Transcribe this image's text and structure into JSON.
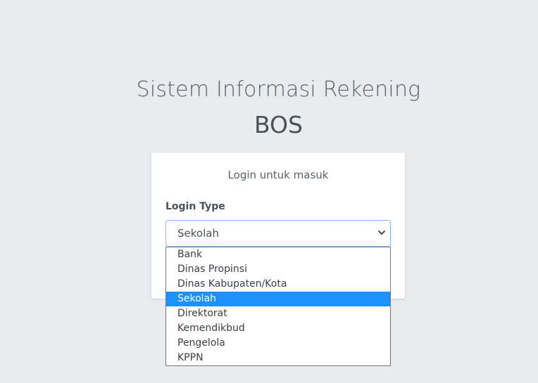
{
  "header": {
    "title": "Sistem Informasi Rekening",
    "subtitle": "BOS"
  },
  "login": {
    "message": "Login untuk masuk",
    "login_type_label": "Login Type",
    "selected_value": "Sekolah",
    "options": [
      "Bank",
      "Dinas Propinsi",
      "Dinas Kabupaten/Kota",
      "Sekolah",
      "Direktorat",
      "Kemendikbud",
      "Pengelola",
      "KPPN"
    ],
    "selected_index": 3
  },
  "colors": {
    "background": "#e9ecef",
    "card": "#ffffff",
    "focus_border": "#80bdff",
    "selected_option": "#1e90ff"
  },
  "icons": {
    "select_arrow": "chevron-down-icon"
  }
}
